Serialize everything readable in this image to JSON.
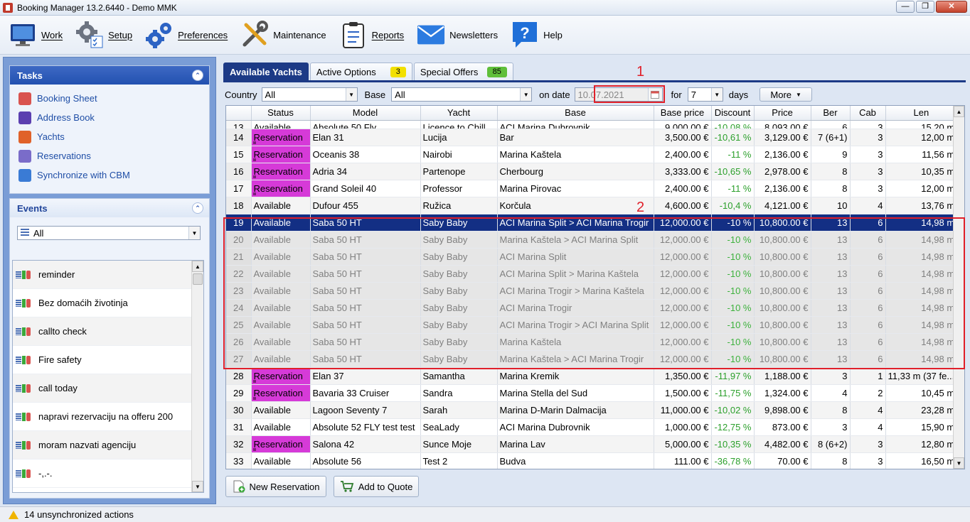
{
  "window": {
    "title": "Booking Manager 13.2.6440 - Demo MMK"
  },
  "menu": [
    {
      "label": "Work",
      "icon": "monitor-icon"
    },
    {
      "label": "Setup",
      "icon": "gears-checklist-icon"
    },
    {
      "label": "Preferences",
      "icon": "gears-icon"
    },
    {
      "label": "Maintenance",
      "icon": "tools-icon"
    },
    {
      "label": "Reports",
      "icon": "clipboard-icon"
    },
    {
      "label": "Newsletters",
      "icon": "envelope-icon"
    },
    {
      "label": "Help",
      "icon": "help-icon"
    }
  ],
  "tasks": {
    "title": "Tasks",
    "items": [
      {
        "label": "Booking Sheet",
        "icon": "calendar-icon",
        "color": "#d9534f"
      },
      {
        "label": "Address Book",
        "icon": "address-book-icon",
        "color": "#5b3fb0"
      },
      {
        "label": "Yachts",
        "icon": "yacht-icon",
        "color": "#e0622a"
      },
      {
        "label": "Reservations",
        "icon": "reservation-icon",
        "color": "#7a6cc9"
      },
      {
        "label": "Synchronize with CBM",
        "icon": "sync-icon",
        "color": "#3a7bd5"
      }
    ]
  },
  "events": {
    "title": "Events",
    "filter": "All",
    "items": [
      "reminder",
      "Bez domaćih životinja",
      "callto check",
      "Fire safety",
      "call today",
      "napravi rezervaciju na offeru 200",
      "moram nazvati agenciju",
      "-,.-."
    ]
  },
  "tabs": [
    {
      "label": "Available Yachts",
      "badge": null,
      "active": true
    },
    {
      "label": "Active Options",
      "badge": "3",
      "badge_color": "#f2e000"
    },
    {
      "label": "Special Offers",
      "badge": "85",
      "badge_color": "#5fbf3a"
    }
  ],
  "filters": {
    "country_label": "Country",
    "country_value": "All",
    "base_label": "Base",
    "base_value": "All",
    "date_label": "on date",
    "date_value": "10.07.2021",
    "for_label": "for",
    "days_value": "7",
    "days_label": "days",
    "more_label": "More"
  },
  "grid": {
    "columns": [
      "",
      "Status",
      "Model",
      "Yacht",
      "Base",
      "Base price",
      "Discount",
      "Price",
      "Ber",
      "Cab",
      "Len"
    ],
    "rows": [
      {
        "n": "13",
        "status": "Available",
        "model": "Absolute 50 Fly",
        "yacht": "Licence to Chill",
        "base": "ACI Marina Dubrovnik",
        "base_price": "9,000.00 €",
        "discount": "-10,08 %",
        "price": "8,093.00 €",
        "ber": "6",
        "cab": "3",
        "len": "15,20 m",
        "kind": "normal"
      },
      {
        "n": "14",
        "status": "Reservation",
        "model": "Elan 31",
        "yacht": "Lucija",
        "base": "Bar",
        "base_price": "3,500.00 €",
        "discount": "-10,61 %",
        "price": "3,129.00 €",
        "ber": "7 (6+1)",
        "cab": "3",
        "len": "12,00 m",
        "kind": "res"
      },
      {
        "n": "15",
        "status": "Reservation",
        "model": "Oceanis 38",
        "yacht": "Nairobi",
        "base": "Marina Kaštela",
        "base_price": "2,400.00 €",
        "discount": "-11 %",
        "price": "2,136.00 €",
        "ber": "9",
        "cab": "3",
        "len": "11,56 m",
        "kind": "res"
      },
      {
        "n": "16",
        "status": "Reservation",
        "model": "Adria 34",
        "yacht": "Partenope",
        "base": "Cherbourg",
        "base_price": "3,333.00 €",
        "discount": "-10,65 %",
        "price": "2,978.00 €",
        "ber": "8",
        "cab": "3",
        "len": "10,35 m",
        "kind": "res"
      },
      {
        "n": "17",
        "status": "Reservation",
        "model": "Grand Soleil 40",
        "yacht": "Professor",
        "base": "Marina Pirovac",
        "base_price": "2,400.00 €",
        "discount": "-11 %",
        "price": "2,136.00 €",
        "ber": "8",
        "cab": "3",
        "len": "12,00 m",
        "kind": "res"
      },
      {
        "n": "18",
        "status": "Available",
        "model": "Dufour 455",
        "yacht": "Ružica",
        "base": "Korčula",
        "base_price": "4,600.00 €",
        "discount": "-10,4 %",
        "price": "4,121.00 €",
        "ber": "10",
        "cab": "4",
        "len": "13,76 m",
        "kind": "normal"
      },
      {
        "n": "19",
        "status": "Available",
        "model": "Saba 50 HT",
        "yacht": "Saby Baby",
        "base": "ACI Marina Split > ACI Marina Trogir",
        "base_price": "12,000.00 €",
        "discount": "-10 %",
        "price": "10,800.00 €",
        "ber": "13",
        "cab": "6",
        "len": "14,98 m",
        "kind": "sel"
      },
      {
        "n": "20",
        "status": "Available",
        "model": "Saba 50 HT",
        "yacht": "Saby Baby",
        "base": "Marina Kaštela > ACI Marina Split",
        "base_price": "12,000.00 €",
        "discount": "-10 %",
        "price": "10,800.00 €",
        "ber": "13",
        "cab": "6",
        "len": "14,98 m",
        "kind": "dim"
      },
      {
        "n": "21",
        "status": "Available",
        "model": "Saba 50 HT",
        "yacht": "Saby Baby",
        "base": "ACI Marina Split",
        "base_price": "12,000.00 €",
        "discount": "-10 %",
        "price": "10,800.00 €",
        "ber": "13",
        "cab": "6",
        "len": "14,98 m",
        "kind": "dim"
      },
      {
        "n": "22",
        "status": "Available",
        "model": "Saba 50 HT",
        "yacht": "Saby Baby",
        "base": "ACI Marina Split > Marina Kaštela",
        "base_price": "12,000.00 €",
        "discount": "-10 %",
        "price": "10,800.00 €",
        "ber": "13",
        "cab": "6",
        "len": "14,98 m",
        "kind": "dim"
      },
      {
        "n": "23",
        "status": "Available",
        "model": "Saba 50 HT",
        "yacht": "Saby Baby",
        "base": "ACI Marina Trogir > Marina Kaštela",
        "base_price": "12,000.00 €",
        "discount": "-10 %",
        "price": "10,800.00 €",
        "ber": "13",
        "cab": "6",
        "len": "14,98 m",
        "kind": "dim"
      },
      {
        "n": "24",
        "status": "Available",
        "model": "Saba 50 HT",
        "yacht": "Saby Baby",
        "base": "ACI Marina Trogir",
        "base_price": "12,000.00 €",
        "discount": "-10 %",
        "price": "10,800.00 €",
        "ber": "13",
        "cab": "6",
        "len": "14,98 m",
        "kind": "dim"
      },
      {
        "n": "25",
        "status": "Available",
        "model": "Saba 50 HT",
        "yacht": "Saby Baby",
        "base": "ACI Marina Trogir > ACI Marina Split",
        "base_price": "12,000.00 €",
        "discount": "-10 %",
        "price": "10,800.00 €",
        "ber": "13",
        "cab": "6",
        "len": "14,98 m",
        "kind": "dim"
      },
      {
        "n": "26",
        "status": "Available",
        "model": "Saba 50 HT",
        "yacht": "Saby Baby",
        "base": "Marina Kaštela",
        "base_price": "12,000.00 €",
        "discount": "-10 %",
        "price": "10,800.00 €",
        "ber": "13",
        "cab": "6",
        "len": "14,98 m",
        "kind": "dim"
      },
      {
        "n": "27",
        "status": "Available",
        "model": "Saba 50 HT",
        "yacht": "Saby Baby",
        "base": "Marina Kaštela > ACI Marina Trogir",
        "base_price": "12,000.00 €",
        "discount": "-10 %",
        "price": "10,800.00 €",
        "ber": "13",
        "cab": "6",
        "len": "14,98 m",
        "kind": "dim"
      },
      {
        "n": "28",
        "status": "Reservation",
        "model": "Elan 37",
        "yacht": "Samantha",
        "base": "Marina Kremik",
        "base_price": "1,350.00 €",
        "discount": "-11,97 %",
        "price": "1,188.00 €",
        "ber": "3",
        "cab": "1",
        "len": "11,33 m (37 fe...",
        "kind": "res"
      },
      {
        "n": "29",
        "status": "Reservation",
        "model": "Bavaria 33 Cruiser",
        "yacht": "Sandra",
        "base": "Marina Stella del Sud",
        "base_price": "1,500.00 €",
        "discount": "-11,75 %",
        "price": "1,324.00 €",
        "ber": "4",
        "cab": "2",
        "len": "10,45 m",
        "kind": "res"
      },
      {
        "n": "30",
        "status": "Available",
        "model": "Lagoon Seventy 7",
        "yacht": "Sarah",
        "base": "Marina D-Marin Dalmacija",
        "base_price": "11,000.00 €",
        "discount": "-10,02 %",
        "price": "9,898.00 €",
        "ber": "8",
        "cab": "4",
        "len": "23,28 m",
        "kind": "normal"
      },
      {
        "n": "31",
        "status": "Available",
        "model": "Absolute 52 FLY test test",
        "yacht": "SeaLady",
        "base": "ACI Marina Dubrovnik",
        "base_price": "1,000.00 €",
        "discount": "-12,75 %",
        "price": "873.00 €",
        "ber": "3",
        "cab": "4",
        "len": "15,90 m",
        "kind": "normal"
      },
      {
        "n": "32",
        "status": "Reservation",
        "model": "Salona 42",
        "yacht": "Sunce Moje",
        "base": "Marina Lav",
        "base_price": "5,000.00 €",
        "discount": "-10,35 %",
        "price": "4,482.00 €",
        "ber": "8 (6+2)",
        "cab": "3",
        "len": "12,80 m",
        "kind": "res"
      },
      {
        "n": "33",
        "status": "Available",
        "model": "Absolute 56",
        "yacht": "Test 2",
        "base": "Budva",
        "base_price": "111.00 €",
        "discount": "-36,78 %",
        "price": "70.00 €",
        "ber": "8",
        "cab": "3",
        "len": "16,50 m",
        "kind": "normal"
      }
    ]
  },
  "annotations": {
    "label1": "1",
    "label2": "2"
  },
  "buttons": {
    "new_reservation": "New Reservation",
    "add_to_quote": "Add to Quote"
  },
  "status": {
    "text": "14 unsynchronized actions"
  },
  "colors": {
    "accent": "#1c3a86",
    "reservation": "#d63ad8",
    "discount": "#2ca02c",
    "annotation": "#e0202a"
  }
}
